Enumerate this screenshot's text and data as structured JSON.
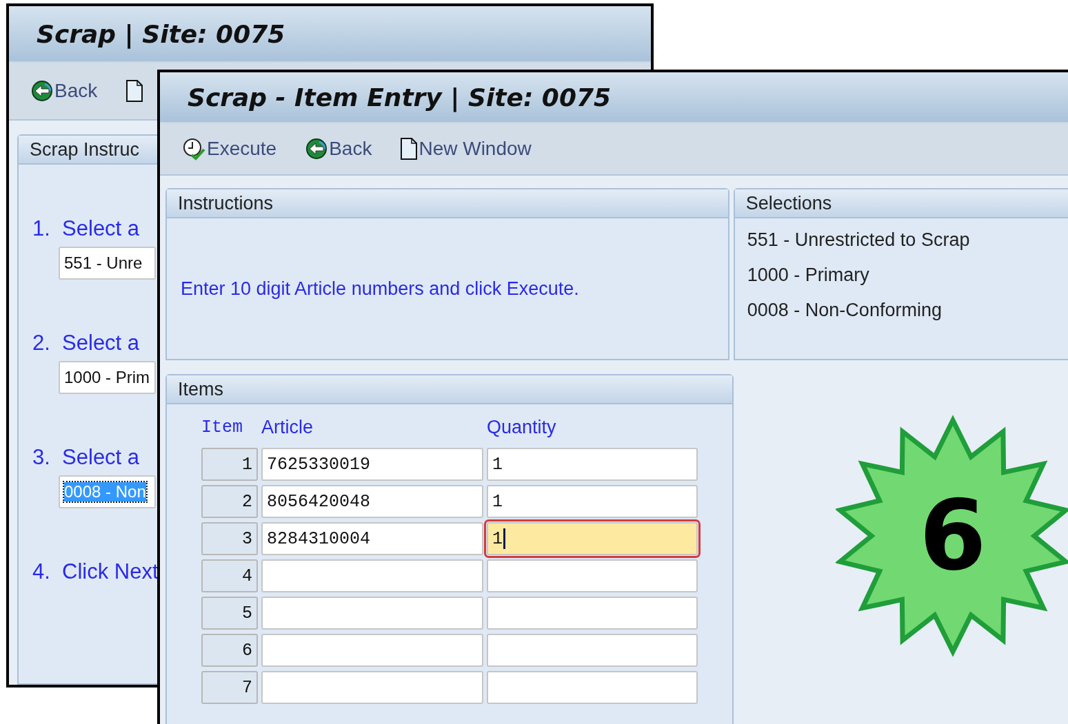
{
  "back_window": {
    "title": "Scrap | Site: 0075",
    "toolbar": [
      {
        "kind": "back",
        "label": "Back"
      },
      {
        "kind": "new_window"
      }
    ],
    "group_title": "Scrap Instruc",
    "steps": [
      {
        "number": "1.",
        "label": "Select a",
        "value": "551 - Unre",
        "highlighted": false
      },
      {
        "number": "2.",
        "label": "Select a",
        "value": "1000 - Prim",
        "highlighted": false
      },
      {
        "number": "3.",
        "label": "Select a",
        "value": "0008 - Non",
        "highlighted": true
      },
      {
        "number": "4.",
        "label": "Click Next"
      }
    ]
  },
  "front_window": {
    "title": "Scrap - Item Entry | Site: 0075",
    "toolbar": [
      {
        "kind": "execute",
        "label": "Execute"
      },
      {
        "kind": "back",
        "label": "Back"
      },
      {
        "kind": "new_window",
        "label": "New Window"
      }
    ],
    "instructions": {
      "title": "Instructions",
      "text": "Enter 10 digit Article numbers and click Execute."
    },
    "selections": {
      "title": "Selections",
      "lines": [
        "551 - Unrestricted to Scrap",
        "1000 - Primary",
        "0008 - Non-Conforming"
      ]
    },
    "items": {
      "title": "Items",
      "columns": [
        "Item",
        "Article",
        "Quantity"
      ],
      "rows": [
        {
          "item": "1",
          "article": "7625330019",
          "quantity": "1",
          "focused": false
        },
        {
          "item": "2",
          "article": "8056420048",
          "quantity": "1",
          "focused": false
        },
        {
          "item": "3",
          "article": "8284310004",
          "quantity": "1",
          "focused": true
        },
        {
          "item": "4",
          "article": "",
          "quantity": "",
          "focused": false
        },
        {
          "item": "5",
          "article": "",
          "quantity": "",
          "focused": false
        },
        {
          "item": "6",
          "article": "",
          "quantity": "",
          "focused": false
        },
        {
          "item": "7",
          "article": "",
          "quantity": "",
          "focused": false
        }
      ]
    }
  },
  "badge": {
    "text": "6"
  }
}
